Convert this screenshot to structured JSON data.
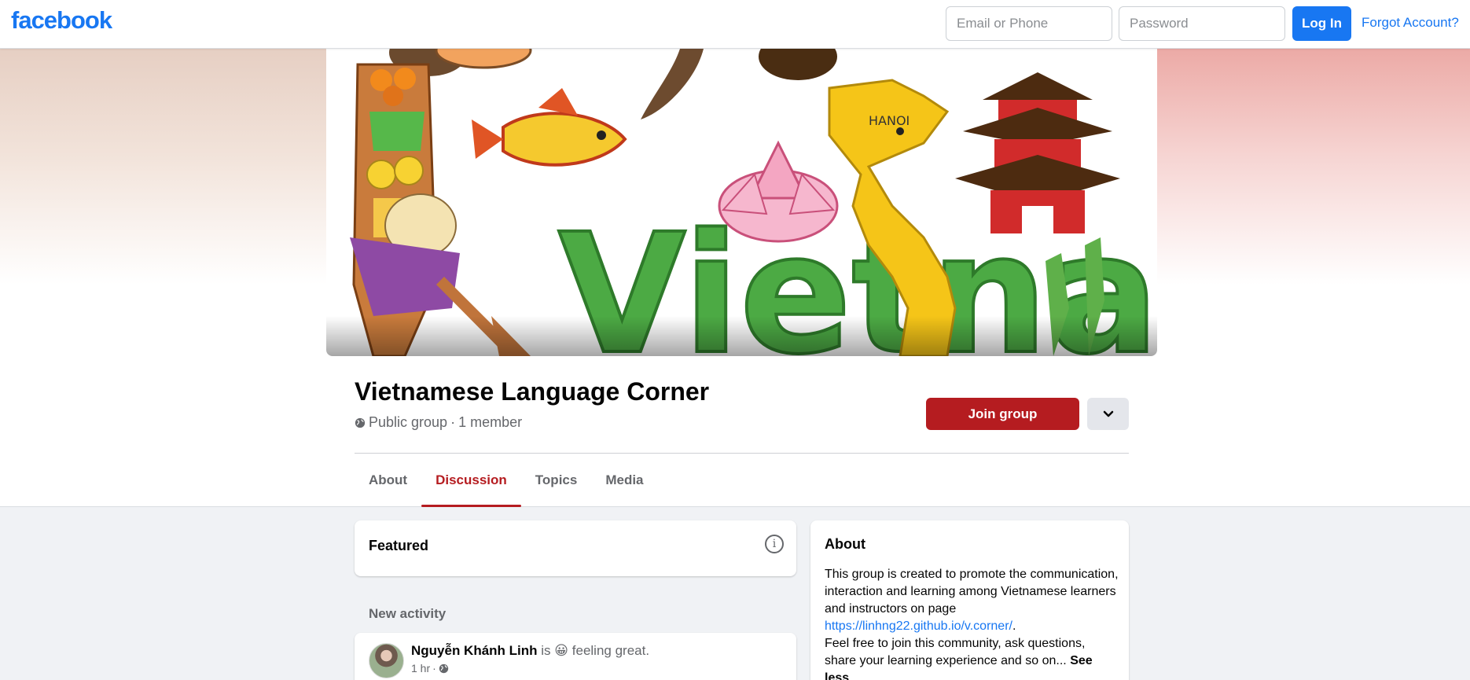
{
  "topbar": {
    "logo": "facebook",
    "email_placeholder": "Email or Phone",
    "password_placeholder": "Password",
    "login_label": "Log In",
    "forgot_label": "Forgot Account?"
  },
  "cover": {
    "map_label": "HANOI",
    "lettering": "Vietnam"
  },
  "group": {
    "name": "Vietnamese Language Corner",
    "privacy": "Public group",
    "separator": "·",
    "members": "1 member",
    "join_label": "Join group"
  },
  "tabs": [
    {
      "label": "About",
      "active": false
    },
    {
      "label": "Discussion",
      "active": true
    },
    {
      "label": "Topics",
      "active": false
    },
    {
      "label": "Media",
      "active": false
    }
  ],
  "featured": {
    "title": "Featured",
    "icon": "info-icon"
  },
  "activity": {
    "heading": "New activity",
    "post": {
      "author": "Nguyễn Khánh Linh",
      "verb": "is",
      "emoji": "😀",
      "feeling": "feeling great.",
      "time": "1 hr",
      "audience_icon": "globe-icon"
    }
  },
  "about": {
    "title": "About",
    "text_1": "This group is created to promote the communication, interaction and learning among Vietnamese learners and instructors on page ",
    "link": "https://linhng22.github.io/v.corner/",
    "text_2": ".",
    "text_3": "Feel free to join this community, ask questions, share your learning experience and so on... ",
    "see_less": "See less"
  },
  "colors": {
    "brand": "#1877f2",
    "group_accent": "#b51c20",
    "page_bg": "#f0f2f5",
    "secondary_text": "#65676b"
  }
}
